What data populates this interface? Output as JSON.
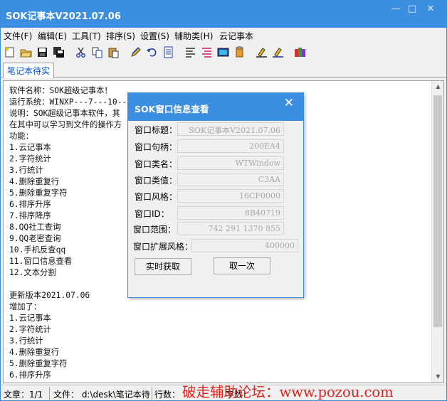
{
  "window": {
    "title": "SOK记事本V2021.07.06",
    "minimize": "—",
    "maximize": "□",
    "close": "✕"
  },
  "menu": [
    "文件(F)",
    "编辑(E)",
    "工具(T)",
    "排序(S)",
    "设置(S)",
    "辅助类(H)",
    "云记事本"
  ],
  "toolbar_icons": [
    "new-file-icon",
    "open-folder-icon",
    "save-icon",
    "save-all-icon",
    "cut-icon",
    "copy-icon",
    "paste-icon",
    "edit-pencil-icon",
    "undo-icon",
    "document-icon",
    "list-icon",
    "list-red-icon",
    "terminal-icon",
    "clipboard-icon",
    "highlight-icon",
    "highlight-alt-icon",
    "color-blocks-icon"
  ],
  "tab": {
    "label": "笔记本待实"
  },
  "editor": {
    "lines": [
      "软件名称：SOK超级记事本！",
      "运行系统：WINXP---7---10---1",
      "说明：SOK超级记事本软件，其",
      "在其中可以学习到文件的操作方",
      "功能：",
      "1.云记事本",
      "2.字符统计",
      "3.行统计",
      "4.删除重复行",
      "5.删除重复字符",
      "6.排序升序",
      "7.排序降序",
      "8.QQ社工查询",
      "9.QQ老密查询",
      "10.手机反查qq",
      "11.窗口信息查看",
      "12.文本分割",
      "",
      "更新版本2021.07.06",
      "增加了：",
      "1.云记事本",
      "2.字符统计",
      "3.行统计",
      "4.删除重复行",
      "5.删除重复字符",
      "6.排序升序"
    ]
  },
  "statusbar": {
    "article": "文章：1/1",
    "file": "文件：  d:\\desk\\笔记本待",
    "lines": "行数：",
    "chars": "字数："
  },
  "watermark": "破走辅助论坛：www.pozou.com",
  "dialog": {
    "title": "SOK窗口信息查看",
    "close": "✕",
    "fields": [
      {
        "label": "窗口标题：",
        "value": "SOK记事本V2021.07.06"
      },
      {
        "label": "窗口句柄：",
        "value": "200EA4"
      },
      {
        "label": "窗口类名：",
        "value": "WTWindow"
      },
      {
        "label": "窗口类值：",
        "value": "C3AA"
      },
      {
        "label": "窗口风格：",
        "value": "16CF0000"
      },
      {
        "label": "窗口ID：",
        "value": "8B40719"
      },
      {
        "label": "窗口范围：",
        "value": "742 291 1370 855"
      },
      {
        "label": "窗口扩展风格：",
        "value": "400000"
      }
    ],
    "buttons": {
      "realtime": "实时获取",
      "get_once": "取一次"
    }
  }
}
